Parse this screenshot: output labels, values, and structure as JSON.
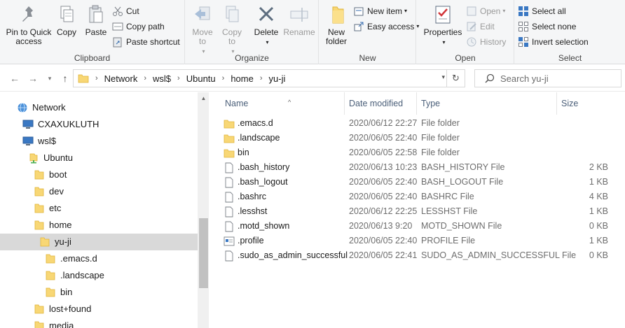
{
  "ribbon": {
    "clipboard": {
      "label": "Clipboard",
      "pin_label": "Pin to Quick access",
      "copy_label": "Copy",
      "paste_label": "Paste",
      "cut_label": "Cut",
      "copy_path_label": "Copy path",
      "paste_shortcut_label": "Paste shortcut"
    },
    "organize": {
      "label": "Organize",
      "move_to_label": "Move to",
      "copy_to_label": "Copy to",
      "delete_label": "Delete",
      "rename_label": "Rename"
    },
    "new": {
      "label": "New",
      "new_folder_label": "New folder",
      "new_item_label": "New item",
      "easy_access_label": "Easy access"
    },
    "open": {
      "label": "Open",
      "properties_label": "Properties",
      "open_label": "Open",
      "edit_label": "Edit",
      "history_label": "History"
    },
    "select": {
      "label": "Select",
      "select_all_label": "Select all",
      "select_none_label": "Select none",
      "invert_label": "Invert selection"
    }
  },
  "address": {
    "crumbs": [
      "Network",
      "wsl$",
      "Ubuntu",
      "home",
      "yu-ji"
    ]
  },
  "search": {
    "placeholder": "Search yu-ji"
  },
  "tree": {
    "items": [
      {
        "label": "Network",
        "icon": "network-icon"
      },
      {
        "label": "CXAXUKLUTH",
        "icon": "computer-icon"
      },
      {
        "label": "wsl$",
        "icon": "computer-icon"
      },
      {
        "label": "Ubuntu",
        "icon": "share-folder-icon"
      },
      {
        "label": "boot",
        "icon": "folder-icon"
      },
      {
        "label": "dev",
        "icon": "folder-icon"
      },
      {
        "label": "etc",
        "icon": "folder-icon"
      },
      {
        "label": "home",
        "icon": "folder-icon"
      },
      {
        "label": "yu-ji",
        "icon": "folder-icon"
      },
      {
        "label": ".emacs.d",
        "icon": "folder-icon"
      },
      {
        "label": ".landscape",
        "icon": "folder-icon"
      },
      {
        "label": "bin",
        "icon": "folder-icon"
      },
      {
        "label": "lost+found",
        "icon": "folder-icon"
      },
      {
        "label": "media",
        "icon": "folder-icon"
      }
    ]
  },
  "columns": {
    "name": "Name",
    "date": "Date modified",
    "type": "Type",
    "size": "Size"
  },
  "files": [
    {
      "name": ".emacs.d",
      "date": "2020/06/12 22:27",
      "type": "File folder",
      "size": "",
      "icon": "folder-icon"
    },
    {
      "name": ".landscape",
      "date": "2020/06/05 22:40",
      "type": "File folder",
      "size": "",
      "icon": "folder-icon"
    },
    {
      "name": "bin",
      "date": "2020/06/05 22:58",
      "type": "File folder",
      "size": "",
      "icon": "folder-icon"
    },
    {
      "name": ".bash_history",
      "date": "2020/06/13 10:23",
      "type": "BASH_HISTORY File",
      "size": "2 KB",
      "icon": "file-icon"
    },
    {
      "name": ".bash_logout",
      "date": "2020/06/05 22:40",
      "type": "BASH_LOGOUT File",
      "size": "1 KB",
      "icon": "file-icon"
    },
    {
      "name": ".bashrc",
      "date": "2020/06/05 22:40",
      "type": "BASHRC File",
      "size": "4 KB",
      "icon": "file-icon"
    },
    {
      "name": ".lesshst",
      "date": "2020/06/12 22:25",
      "type": "LESSHST File",
      "size": "1 KB",
      "icon": "file-icon"
    },
    {
      "name": ".motd_shown",
      "date": "2020/06/13 9:20",
      "type": "MOTD_SHOWN File",
      "size": "0 KB",
      "icon": "file-icon"
    },
    {
      "name": ".profile",
      "date": "2020/06/05 22:40",
      "type": "PROFILE File",
      "size": "1 KB",
      "icon": "profile-file-icon"
    },
    {
      "name": ".sudo_as_admin_successful",
      "date": "2020/06/05 22:41",
      "type": "SUDO_AS_ADMIN_SUCCESSFUL File",
      "size": "0 KB",
      "icon": "file-icon"
    }
  ]
}
